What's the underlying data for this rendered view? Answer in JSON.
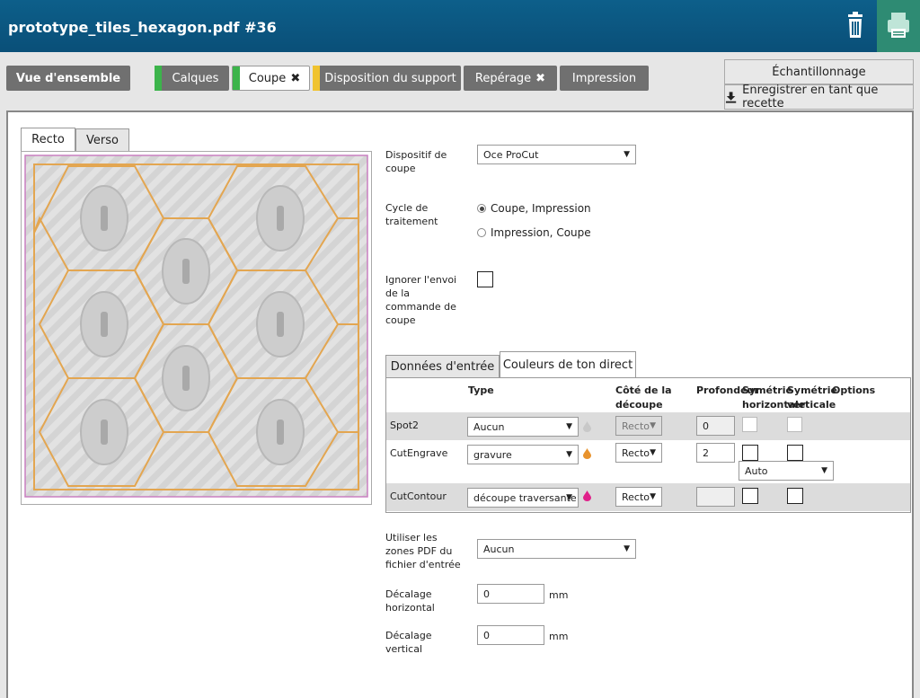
{
  "header": {
    "title": "prototype_tiles_hexagon.pdf #36"
  },
  "tabs": [
    {
      "label": "Vue d'ensemble"
    },
    {
      "label": "Calques",
      "stripe": "#3cb44b"
    },
    {
      "label": "Coupe",
      "stripe": "#3cb44b",
      "close": "✖"
    },
    {
      "label": "Disposition du support",
      "stripe": "#f0c330"
    },
    {
      "label": "Repérage",
      "close": "✖"
    },
    {
      "label": "Impression"
    }
  ],
  "actions": {
    "sampling": "Échantillonnage",
    "save_recipe": "Enregistrer en tant que recette"
  },
  "side_tabs": {
    "recto": "Recto",
    "verso": "Verso"
  },
  "form": {
    "device_label": "Dispositif de coupe",
    "device_value": "Oce ProCut",
    "cycle_label": "Cycle de traitement",
    "cycle_options": [
      "Coupe, Impression",
      "Impression, Coupe"
    ],
    "ignore_label": "Ignorer l'envoi de la commande de coupe",
    "pdf_zones_label": "Utiliser les zones PDF du fichier d'entrée",
    "pdf_zones_value": "Aucun",
    "hoffset_label": "Décalage horizontal",
    "hoffset_value": "0",
    "voffset_label": "Décalage vertical",
    "voffset_value": "0",
    "unit": "mm"
  },
  "inner_tabs": {
    "input_data": "Données d'entrée",
    "spot_colors": "Couleurs de ton direct"
  },
  "table": {
    "headers": {
      "type": "Type",
      "side": "Côté de la découpe",
      "depth": "Profondeur",
      "hsym": "Symétrie horizontale",
      "vsym": "Symétrie verticale",
      "options": "Options"
    },
    "rows": [
      {
        "name": "Spot2",
        "type": "Aucun",
        "side": "Recto",
        "depth": "0",
        "drop_color": "#c8c8c8"
      },
      {
        "name": "CutEngrave",
        "type": "gravure",
        "side": "Recto",
        "depth": "2",
        "option": "Auto",
        "drop_color": "#e8932d"
      },
      {
        "name": "CutContour",
        "type": "découpe traversante",
        "side": "Recto",
        "depth": "",
        "drop_color": "#e0208a"
      }
    ]
  },
  "icons": {
    "trash": "trash-icon",
    "printer": "printer-icon",
    "download": "download-icon"
  },
  "colors": {
    "header": "#0d5f8a",
    "print_button": "#2e8b73",
    "tab_inactive": "#707070"
  }
}
